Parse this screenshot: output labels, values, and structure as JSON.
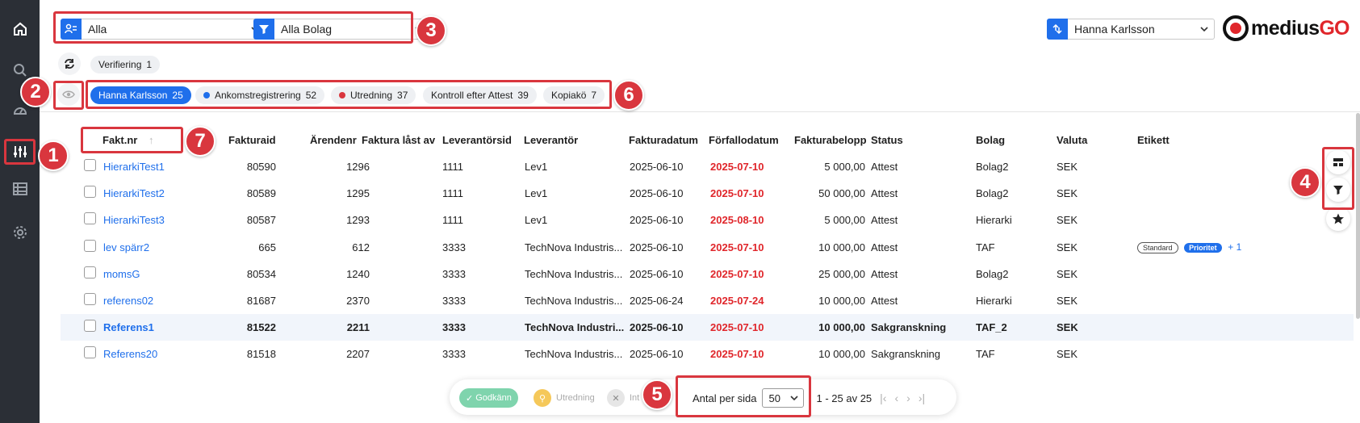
{
  "rail": {
    "icons": [
      "home-icon",
      "search-icon",
      "dashboard-icon",
      "sliders-icon",
      "list-settings-icon",
      "gear-icon"
    ]
  },
  "top": {
    "view_select": "Alla",
    "company_select": "Alla Bolag",
    "user_select": "Hanna Karlsson"
  },
  "logo": {
    "text": "medius",
    "suffix": "GO"
  },
  "verify_chip": {
    "label": "Verifiering",
    "count": "1"
  },
  "chips": [
    {
      "label": "Hanna Karlsson",
      "count": "25",
      "active": true,
      "dot": ""
    },
    {
      "label": "Ankomstregistrering",
      "count": "52",
      "active": false,
      "dot": "#1f6feb"
    },
    {
      "label": "Utredning",
      "count": "37",
      "active": false,
      "dot": "#d9363e"
    },
    {
      "label": "Kontroll efter Attest",
      "count": "39",
      "active": false,
      "dot": ""
    },
    {
      "label": "Kopiakö",
      "count": "7",
      "active": false,
      "dot": ""
    }
  ],
  "columns": [
    "Fakt.nr",
    "Fakturaid",
    "Ärendenr",
    "Faktura låst av",
    "Leverantörsid",
    "Leverantör",
    "Fakturadatum",
    "Förfallodatum",
    "Fakturabelopp",
    "Status",
    "Bolag",
    "Valuta",
    "Etikett"
  ],
  "rows": [
    {
      "nr": "HierarkiTest1",
      "id": "80590",
      "arende": "1296",
      "last": "",
      "levid": "1111",
      "lev": "Lev1",
      "fdatum": "2025-06-10",
      "forfall": "2025-07-10",
      "belopp": "5 000,00",
      "status": "Attest",
      "bolag": "Bolag2",
      "valuta": "SEK"
    },
    {
      "nr": "HierarkiTest2",
      "id": "80589",
      "arende": "1295",
      "last": "",
      "levid": "1111",
      "lev": "Lev1",
      "fdatum": "2025-06-10",
      "forfall": "2025-07-10",
      "belopp": "50 000,00",
      "status": "Attest",
      "bolag": "Bolag2",
      "valuta": "SEK"
    },
    {
      "nr": "HierarkiTest3",
      "id": "80587",
      "arende": "1293",
      "last": "",
      "levid": "1111",
      "lev": "Lev1",
      "fdatum": "2025-06-10",
      "forfall": "2025-08-10",
      "belopp": "5 000,00",
      "status": "Attest",
      "bolag": "Hierarki",
      "valuta": "SEK"
    },
    {
      "nr": "lev spärr2",
      "id": "665",
      "arende": "612",
      "last": "",
      "levid": "3333",
      "lev": "TechNova Industris...",
      "fdatum": "2025-06-10",
      "forfall": "2025-07-10",
      "belopp": "10 000,00",
      "status": "Attest",
      "bolag": "TAF",
      "valuta": "SEK"
    },
    {
      "nr": "momsG",
      "id": "80534",
      "arende": "1240",
      "last": "",
      "levid": "3333",
      "lev": "TechNova Industris...",
      "fdatum": "2025-06-10",
      "forfall": "2025-07-10",
      "belopp": "25 000,00",
      "status": "Attest",
      "bolag": "Bolag2",
      "valuta": "SEK"
    },
    {
      "nr": "referens02",
      "id": "81687",
      "arende": "2370",
      "last": "",
      "levid": "3333",
      "lev": "TechNova Industris...",
      "fdatum": "2025-06-24",
      "forfall": "2025-07-24",
      "belopp": "10 000,00",
      "status": "Attest",
      "bolag": "Hierarki",
      "valuta": "SEK"
    },
    {
      "nr": "Referens1",
      "id": "81522",
      "arende": "2211",
      "last": "",
      "levid": "3333",
      "lev": "TechNova Industri...",
      "fdatum": "2025-06-10",
      "forfall": "2025-07-10",
      "belopp": "10 000,00",
      "status": "Sakgranskning",
      "bolag": "TAF_2",
      "valuta": "SEK"
    },
    {
      "nr": "Referens20",
      "id": "81518",
      "arende": "2207",
      "last": "",
      "levid": "3333",
      "lev": "TechNova Industris...",
      "fdatum": "2025-06-10",
      "forfall": "2025-07-10",
      "belopp": "10 000,00",
      "status": "Sakgranskning",
      "bolag": "TAF",
      "valuta": "SEK"
    }
  ],
  "tags": {
    "tag1": "Standard",
    "tag2": "Prioritet",
    "more": "+ 1"
  },
  "bottom": {
    "approve": "Godkänn",
    "investigate": "Utredning",
    "partial": "Int",
    "per_page_label": "Antal per sida",
    "per_page_value": "50",
    "range": "1 - 25 av 25"
  },
  "callouts": [
    "1",
    "2",
    "3",
    "4",
    "5",
    "6",
    "7"
  ]
}
